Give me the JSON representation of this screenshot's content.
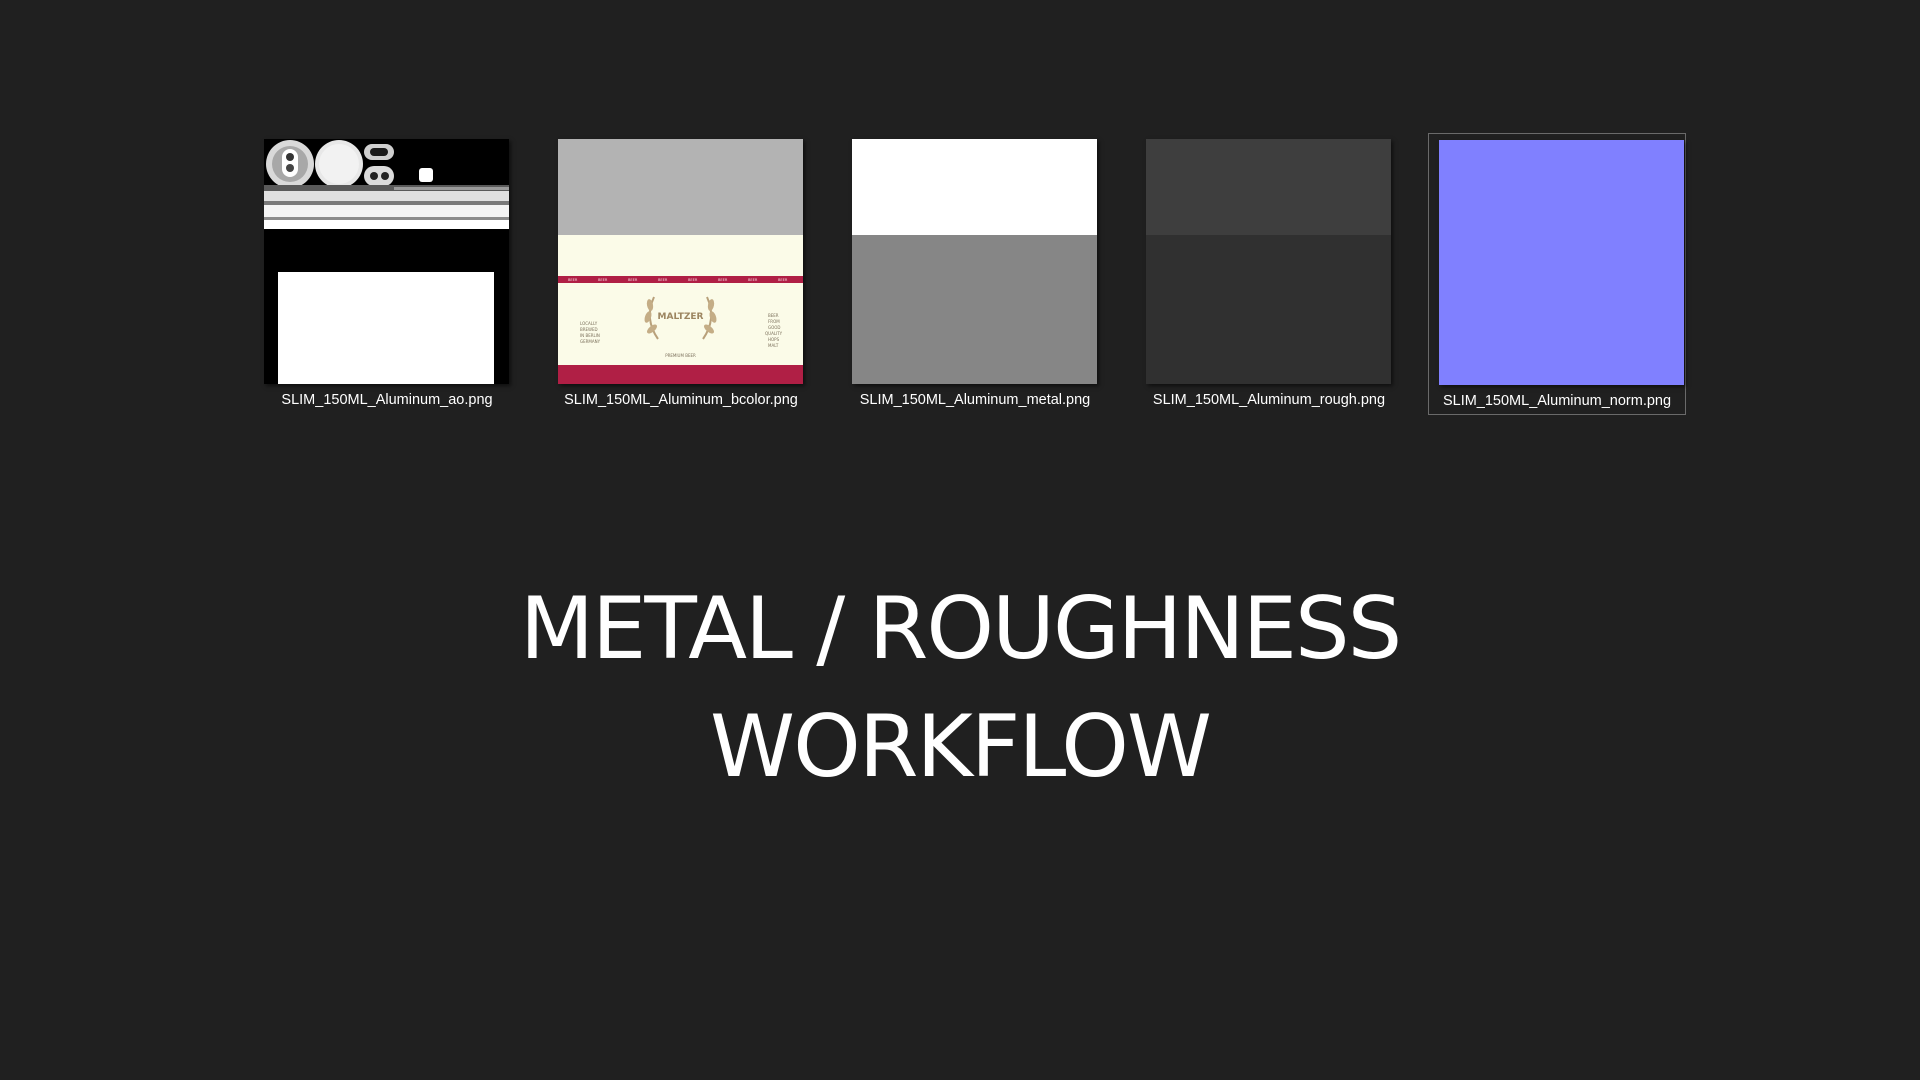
{
  "files": [
    {
      "id": "ao",
      "filename": "SLIM_150ML_Aluminum_ao.png",
      "icon": "ao-texture-thumbnail"
    },
    {
      "id": "bcolor",
      "filename": "SLIM_150ML_Aluminum_bcolor.png",
      "icon": "bcolor-texture-thumbnail",
      "label_art": {
        "brand": "MALTZER",
        "left_text": [
          "LOCALLY",
          "BREWED",
          "IN BERLIN",
          "GERMANY"
        ],
        "right_text": [
          "BEER",
          "FROM",
          "GOOD",
          "QUALITY",
          "HOPS",
          "MALT"
        ],
        "bottom_text": "PREMIUM BEER",
        "band_text": "BEER"
      }
    },
    {
      "id": "metal",
      "filename": "SLIM_150ML_Aluminum_metal.png",
      "icon": "metal-texture-thumbnail"
    },
    {
      "id": "rough",
      "filename": "SLIM_150ML_Aluminum_rough.png",
      "icon": "rough-texture-thumbnail"
    },
    {
      "id": "norm",
      "filename": "SLIM_150ML_Aluminum_norm.png",
      "icon": "norm-texture-thumbnail",
      "selected": true
    }
  ],
  "title": {
    "line1": "METAL / ROUGHNESS",
    "line2": "WORKFLOW"
  },
  "colors": {
    "background": "#202020",
    "normal_map": "#8080ff",
    "label_cream": "#fbfbe8",
    "label_red": "#b01f45"
  }
}
